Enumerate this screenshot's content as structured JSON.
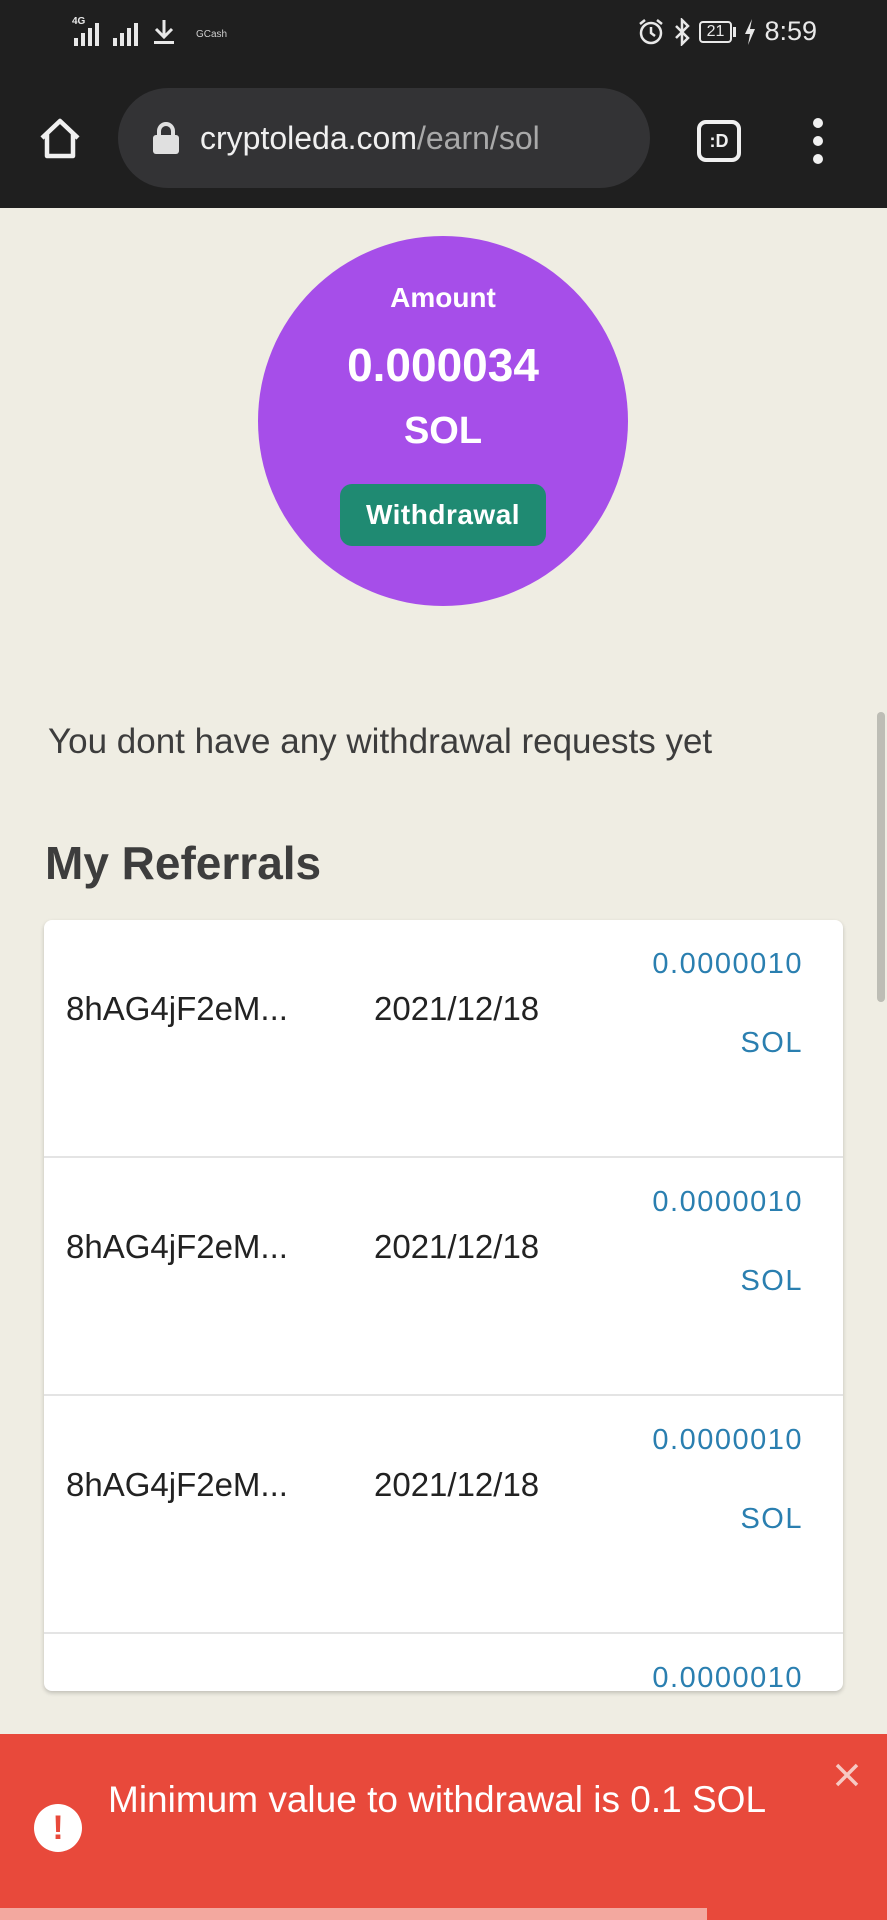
{
  "status_bar": {
    "network_tag": "4G",
    "carrier_label": "GCash",
    "battery": "21",
    "time": "8:59"
  },
  "browser": {
    "url_domain": "cryptoleda.com",
    "url_path": "/earn/sol",
    "tabs_label": ":D"
  },
  "wallet": {
    "amount_label": "Amount",
    "amount_value": "0.000034",
    "amount_unit": "SOL",
    "withdraw_label": "Withdrawal"
  },
  "withdrawals": {
    "empty_message": "You dont have any withdrawal requests yet"
  },
  "referrals": {
    "title": "My Referrals",
    "rows": [
      {
        "address": "8hAG4jF2eM...",
        "date": "2021/12/18",
        "amount": "0.0000010",
        "unit": "SOL"
      },
      {
        "address": "8hAG4jF2eM...",
        "date": "2021/12/18",
        "amount": "0.0000010",
        "unit": "SOL"
      },
      {
        "address": "8hAG4jF2eM...",
        "date": "2021/12/18",
        "amount": "0.0000010",
        "unit": "SOL"
      },
      {
        "address": "",
        "date": "",
        "amount": "0.0000010",
        "unit": ""
      }
    ]
  },
  "toast": {
    "message": "Minimum value to withdrawal is 0.1 SOL"
  },
  "colors": {
    "page_bg": "#efede3",
    "circle": "#a64ee9",
    "withdraw_btn": "#1f8a72",
    "amount_text": "#2a7fb0",
    "toast_bg": "#e8493b"
  }
}
